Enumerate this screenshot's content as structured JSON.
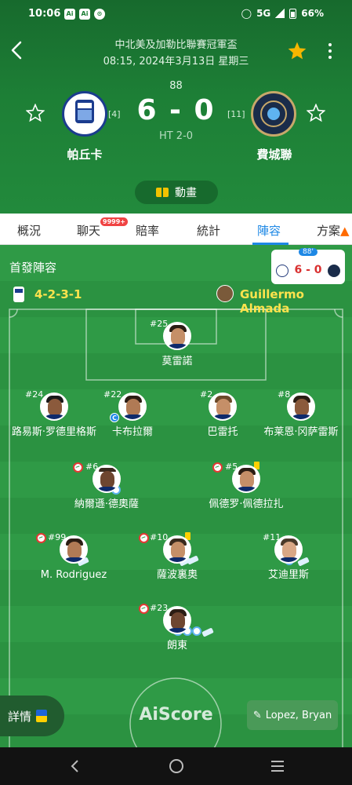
{
  "status_bar": {
    "time": "10:06",
    "left_icons": [
      "Ai",
      "Ai",
      "⊙"
    ],
    "right_text": "66%",
    "network": "5G"
  },
  "header": {
    "league": "中北美及加勒比聯賽冠軍盃",
    "datetime": "08:15, 2024年3月13日 星期三",
    "minute": "88",
    "score": "6 - 0",
    "halftime": "HT 2-0",
    "home": {
      "name": "帕丘卡",
      "rank": "[4]"
    },
    "away": {
      "name": "費城聯",
      "rank": "[11]"
    },
    "animation_label": "動畫",
    "accent": "#f6b600"
  },
  "tabs": [
    {
      "label": "概況"
    },
    {
      "label": "聊天",
      "badge": "9999+"
    },
    {
      "label": "賠率"
    },
    {
      "label": "統計"
    },
    {
      "label": "陣容",
      "active": true
    },
    {
      "label": "方案"
    }
  ],
  "lineup": {
    "title": "首發陣容",
    "mini_time": "88'",
    "mini_score": "6 - 0",
    "formation": "4-2-3-1",
    "coach": "Guillermo Almada",
    "players": [
      {
        "num": "#25",
        "name": "莫雷諾"
      },
      {
        "num": "#24",
        "name": "路易斯·罗德里格斯"
      },
      {
        "num": "#22",
        "name": "卡布拉爾"
      },
      {
        "num": "#2",
        "name": "巴雷托"
      },
      {
        "num": "#8",
        "name": "布莱恩·冈萨雷斯"
      },
      {
        "num": "#6",
        "name": "納爾遜·德奧薩"
      },
      {
        "num": "#5",
        "name": "佩德罗·佩德拉扎"
      },
      {
        "num": "#99",
        "name": "M. Rodriguez"
      },
      {
        "num": "#10",
        "name": "薩波裏奧"
      },
      {
        "num": "#11",
        "name": "艾迪里斯"
      },
      {
        "num": "#23",
        "name": "朗東"
      }
    ],
    "details_label": "詳情",
    "watermark": "AiScore",
    "referee": "Lopez, Bryan"
  }
}
